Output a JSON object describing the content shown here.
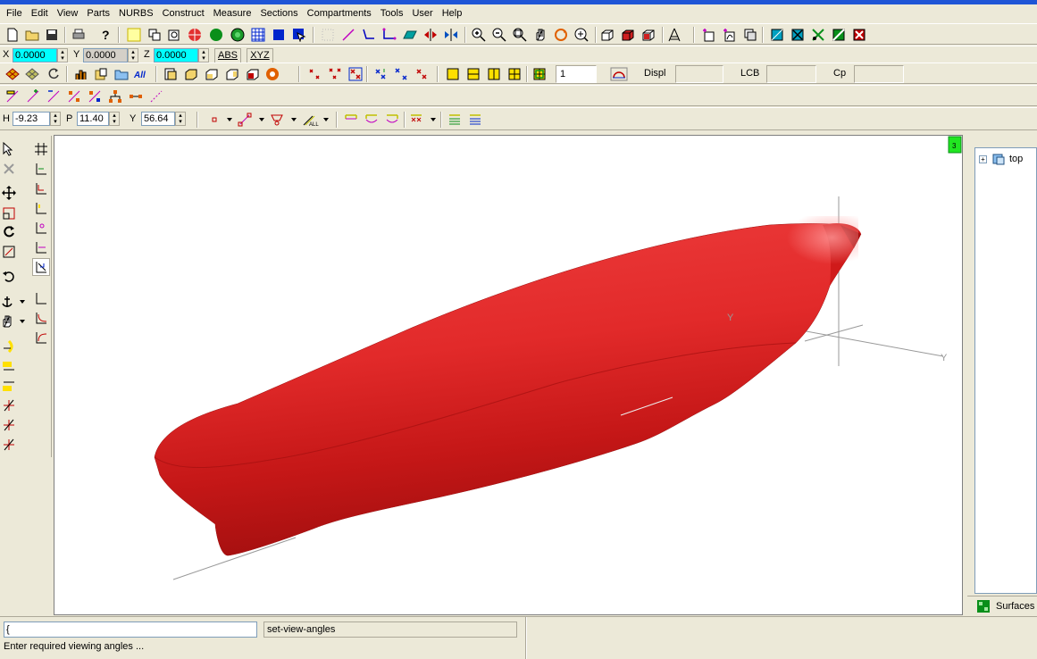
{
  "menu": [
    "File",
    "Edit",
    "View",
    "Parts",
    "NURBS",
    "Construct",
    "Measure",
    "Sections",
    "Compartments",
    "Tools",
    "User",
    "Help"
  ],
  "coords": {
    "x_label": "X",
    "x_value": "0.0000",
    "y_label": "Y",
    "y_value": "0.0000",
    "z_label": "Z",
    "z_value": "0.0000",
    "abs_label": "ABS",
    "xyz_label": "XYZ"
  },
  "hydro": {
    "count_value": "1",
    "displ_label": "Displ",
    "lcb_label": "LCB",
    "cp_label": "Cp"
  },
  "view_angles": {
    "h_label": "H",
    "h_value": "-9.23",
    "p_label": "P",
    "p_value": "11.40",
    "y_label": "Y",
    "y_value": "56.64"
  },
  "viewport": {
    "badge": "3",
    "axis_y1": "Y",
    "axis_y2": "Y",
    "hull_color": "#e0262a"
  },
  "tree": {
    "expander": "+",
    "root_label": "top"
  },
  "right_tab": {
    "label": "Surfaces"
  },
  "status": {
    "command_input": "{",
    "command_output": "set-view-angles",
    "prompt": "Enter required viewing angles ..."
  },
  "icons": {
    "toolbar1": [
      "new-file-icon",
      "open-file-icon",
      "save-icon",
      "print-icon",
      "help-icon",
      "select-box-icon",
      "copy-icon",
      "paste-icon",
      "sphere-icon",
      "green-sphere-icon",
      "green-circle-icon",
      "grid-icon",
      "blue-square-icon",
      "select-arrow-icon",
      "points-grid-icon",
      "curve-icon",
      "polyline-icon",
      "plane-icon",
      "mirror-icon",
      "mirror-v-icon",
      "zoom-in-icon",
      "zoom-out-icon",
      "zoom-window-icon",
      "pan-icon",
      "rotate-icon",
      "zoom-fit-icon",
      "box-view-icon",
      "box-solid-icon",
      "box-wire-icon",
      "tripod-icon",
      "add-surface-icon",
      "add-curve-icon",
      "copy-surface-icon",
      "blend-icon",
      "cut-icon",
      "split-icon",
      "trim-icon",
      "delete-surface-icon"
    ]
  }
}
